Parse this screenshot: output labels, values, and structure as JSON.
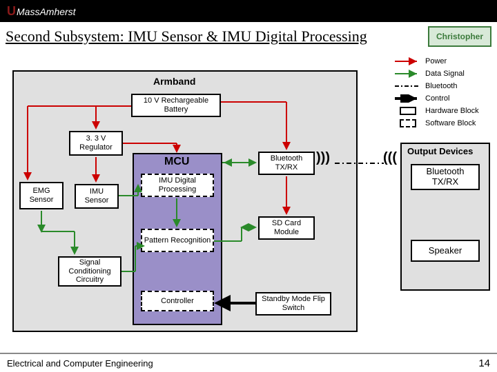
{
  "header": {
    "logo_prefix": "U",
    "logo_text": "MassAmherst"
  },
  "title": "Second Subsystem: IMU Sensor & IMU Digital Processing",
  "author": "Christopher",
  "armband": {
    "label": "Armband",
    "battery": "10 V Rechargeable\nBattery",
    "regulator": "3. 3 V\nRegulator",
    "emg": "EMG\nSensor",
    "imu": "IMU\nSensor",
    "scc": "Signal\nConditioning\nCircuitry",
    "bt": "Bluetooth\nTX/RX",
    "sd": "SD Card\nModule",
    "standby": "Standby Mode\nFlip Switch"
  },
  "mcu": {
    "label": "MCU",
    "idp": "IMU Digital\nProcessing",
    "pattern": "Pattern\nRecognition",
    "controller": "Controller"
  },
  "output": {
    "label": "Output Devices",
    "bt": "Bluetooth\nTX/RX",
    "speaker": "Speaker"
  },
  "legend": {
    "power": "Power",
    "data": "Data Signal",
    "bluetooth": "Bluetooth",
    "control": "Control",
    "hw": "Hardware Block",
    "sw": "Software Block"
  },
  "footer": {
    "dept": "Electrical and Computer Engineering",
    "page": "14"
  }
}
